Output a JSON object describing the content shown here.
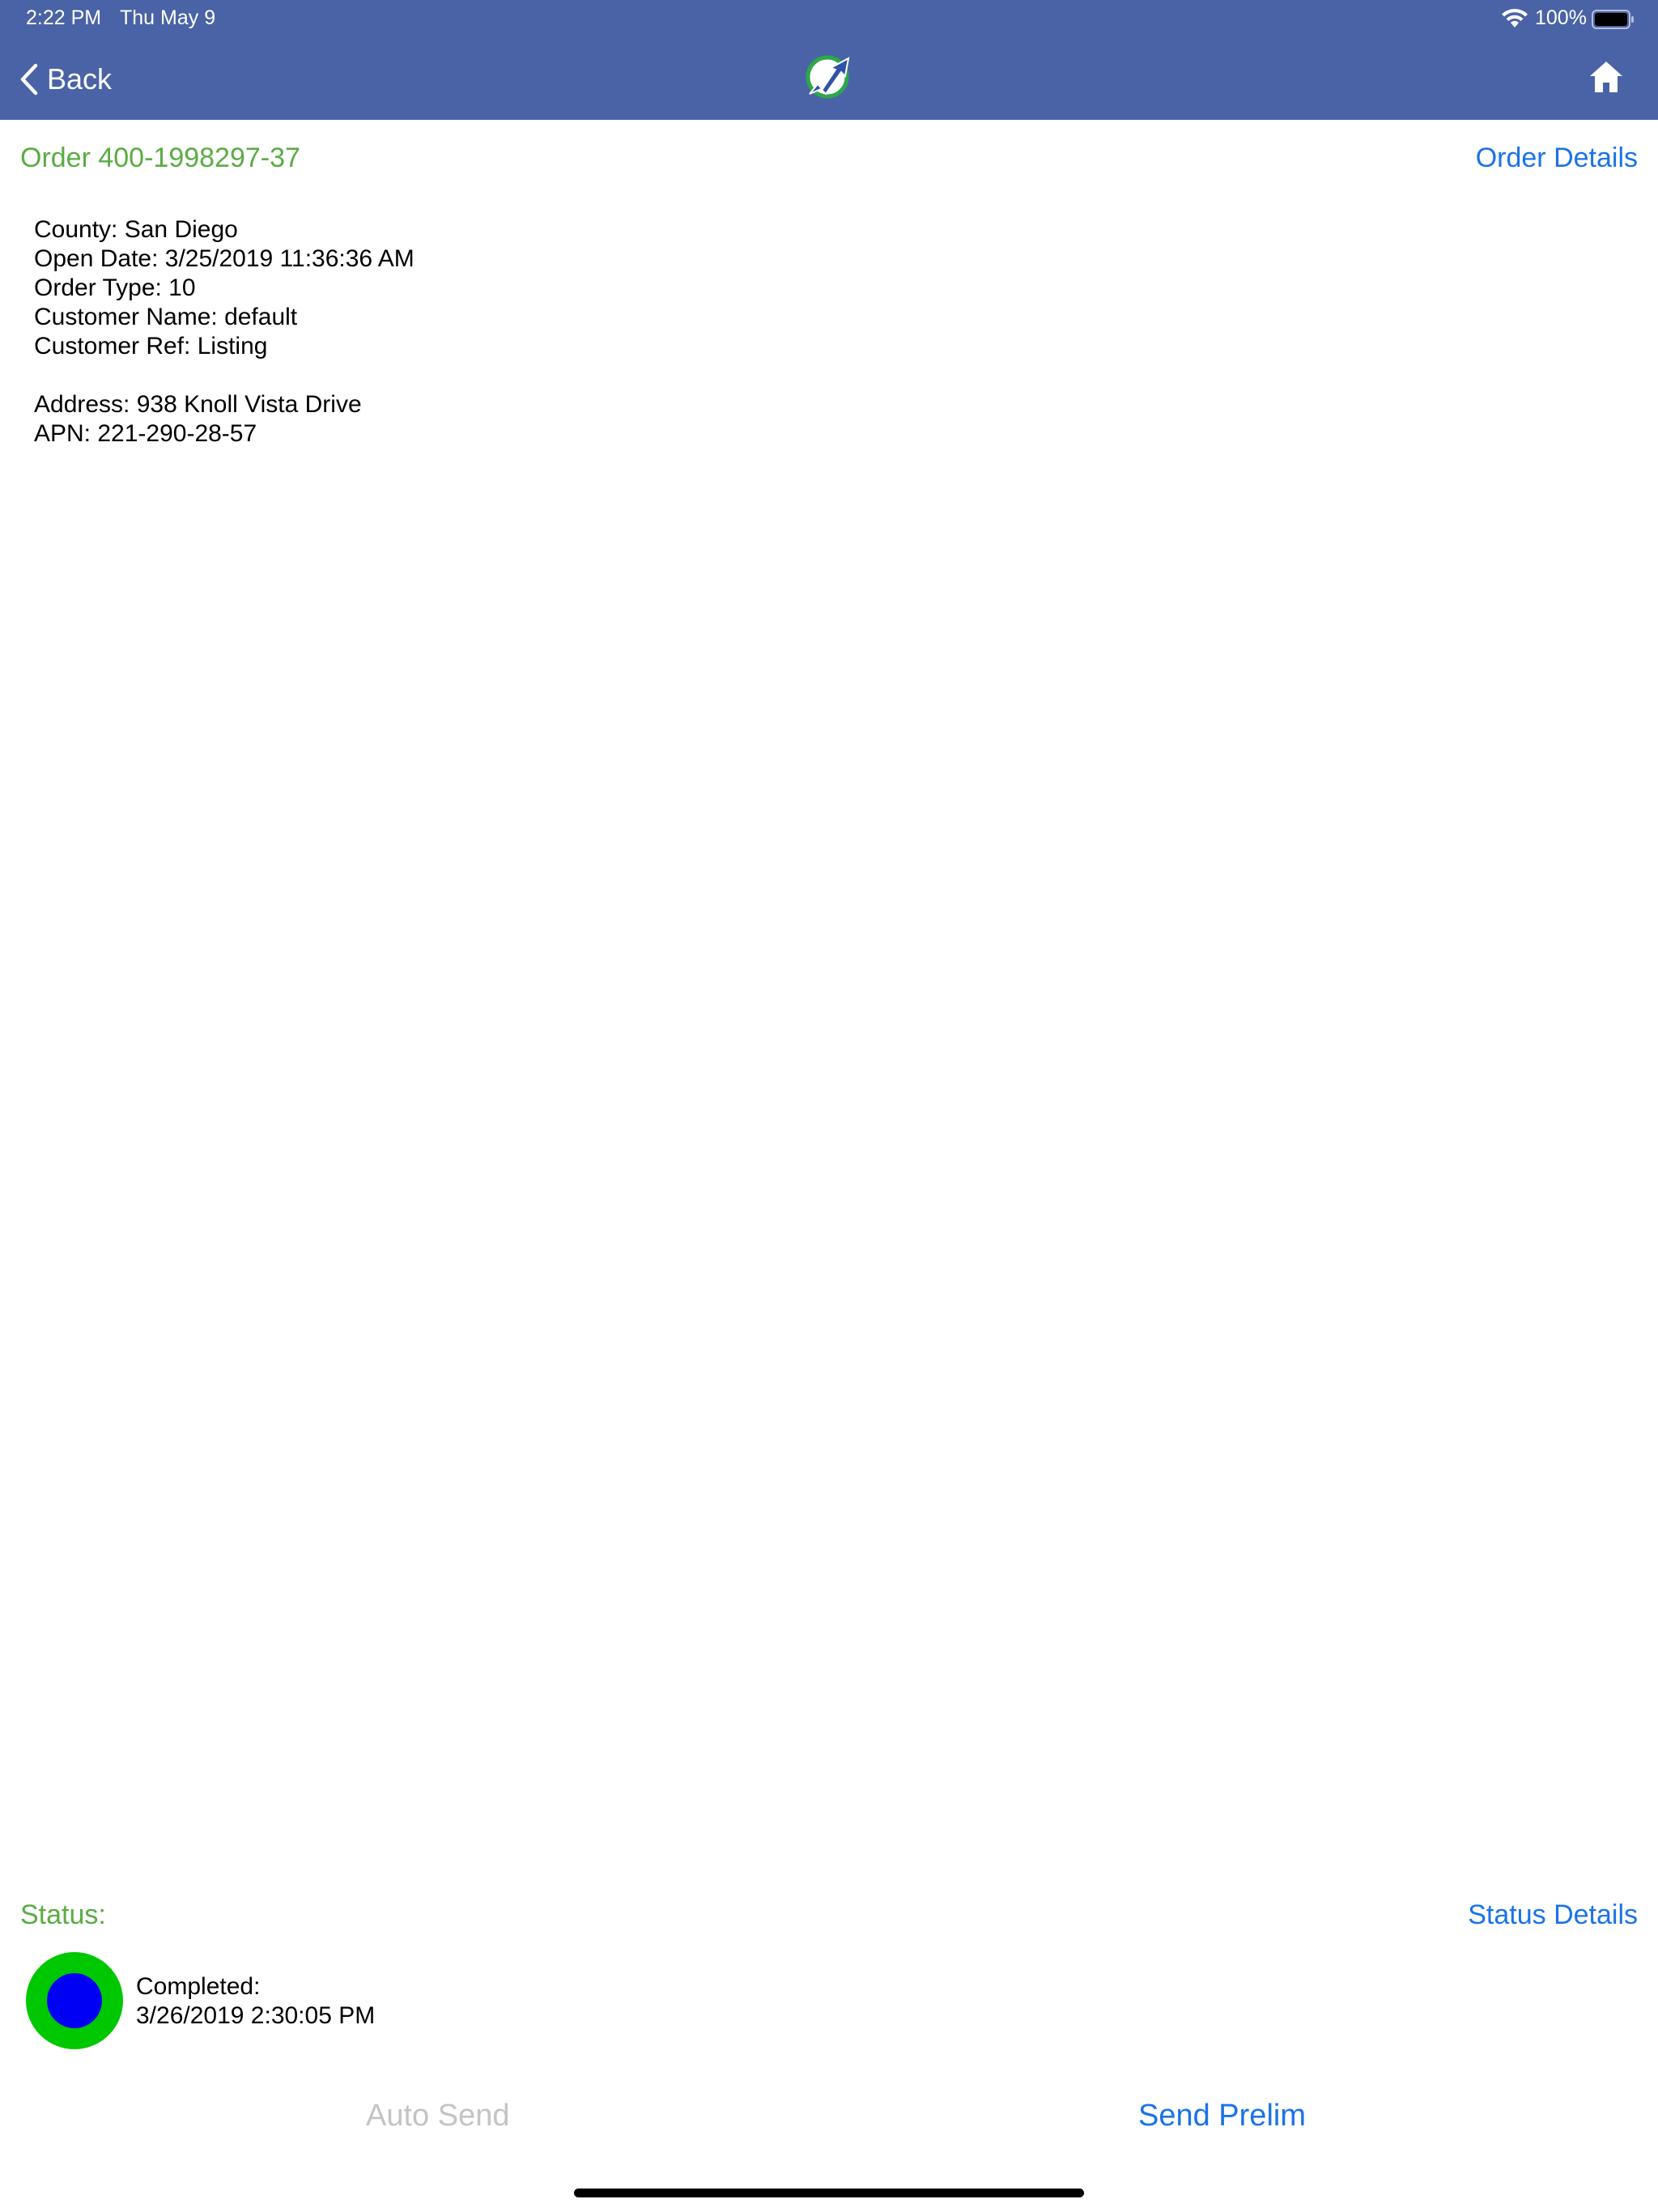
{
  "status_bar": {
    "time": "2:22 PM",
    "date": "Thu May 9",
    "battery": "100%"
  },
  "nav": {
    "back_label": "Back",
    "logo_icon": "app-logo-icon",
    "home_icon": "home-icon",
    "bar_color": "#4a63a6"
  },
  "order": {
    "title": "Order 400-1998297-37",
    "details_link": "Order Details",
    "county": "County: San Diego",
    "open_date": "Open Date: 3/25/2019 11:36:36 AM",
    "order_type": "Order Type: 10",
    "customer_name": "Customer Name: default",
    "customer_ref": "Customer Ref: Listing",
    "address": "Address: 938 Knoll Vista Drive",
    "apn": "APN: 221-290-28-57"
  },
  "status": {
    "label": "Status:",
    "details_link": "Status Details",
    "state": "Completed:",
    "timestamp": "3/26/2019 2:30:05 PM",
    "outer_color": "#00c800",
    "inner_color": "#0000f5"
  },
  "actions": {
    "auto_send": "Auto Send",
    "send_prelim": "Send Prelim"
  },
  "colors": {
    "title_green": "#5aac43",
    "link_blue": "#1a73e8",
    "disabled_gray": "#c4c4c4"
  }
}
